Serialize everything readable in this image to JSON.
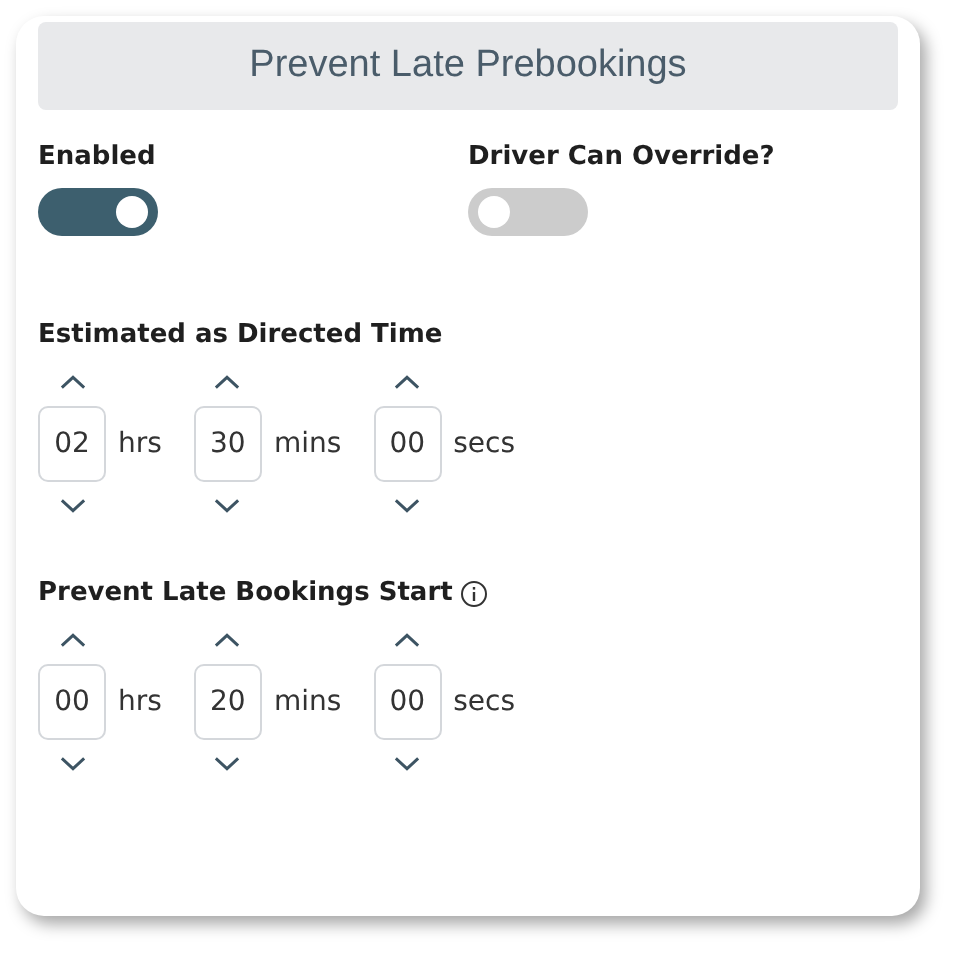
{
  "title": "Prevent Late Prebookings",
  "toggles": [
    {
      "label": "Enabled",
      "on": true
    },
    {
      "label": "Driver Can Override?",
      "on": false
    }
  ],
  "time_groups": [
    {
      "label": "Estimated as Directed Time",
      "info": false,
      "fields": [
        {
          "value": "02",
          "unit": "hrs"
        },
        {
          "value": "30",
          "unit": "mins"
        },
        {
          "value": "00",
          "unit": "secs"
        }
      ]
    },
    {
      "label": "Prevent Late Bookings Start",
      "info": true,
      "fields": [
        {
          "value": "00",
          "unit": "hrs"
        },
        {
          "value": "20",
          "unit": "mins"
        },
        {
          "value": "00",
          "unit": "secs"
        }
      ]
    }
  ]
}
